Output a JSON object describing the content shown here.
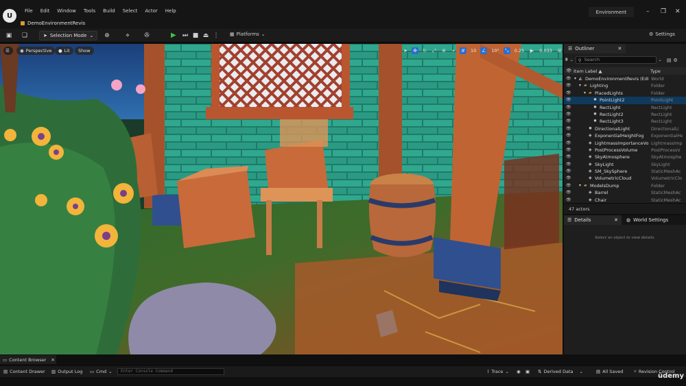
{
  "app": {
    "logo": "unreal-engine-logo",
    "menu": [
      "File",
      "Edit",
      "Window",
      "Tools",
      "Build",
      "Select",
      "Actor",
      "Help"
    ],
    "project_tab": "DemoEnvironmentRevis",
    "environment_label": "Environment"
  },
  "toolbar": {
    "selection_mode": "Selection Mode",
    "platforms": "Platforms",
    "settings": "Settings"
  },
  "viewport": {
    "perspective": "Perspective",
    "lit": "Lit",
    "show": "Show",
    "grid_snap": "10",
    "rotation_snap": "10°",
    "scale_snap": "0.25",
    "camera_speed": "0.033"
  },
  "outliner": {
    "tab_label": "Outliner",
    "search_placeholder": "Search",
    "col_label": "Item Label ▲",
    "col_type": "Type",
    "rows": [
      {
        "name": "DemoEnvironmentRevis (Edit",
        "type": "World",
        "indent": 0,
        "icon": "world",
        "selected": false
      },
      {
        "name": "Lighting",
        "type": "Folder",
        "indent": 1,
        "icon": "folder",
        "selected": false
      },
      {
        "name": "PlacedLights",
        "type": "Folder",
        "indent": 2,
        "icon": "folder",
        "selected": false
      },
      {
        "name": "PointLight2",
        "type": "PointLight",
        "indent": 3,
        "icon": "light",
        "selected": true
      },
      {
        "name": "RectLight",
        "type": "RectLight",
        "indent": 3,
        "icon": "light",
        "selected": false
      },
      {
        "name": "RectLight2",
        "type": "RectLight",
        "indent": 3,
        "icon": "light",
        "selected": false
      },
      {
        "name": "RectLight3",
        "type": "RectLight",
        "indent": 3,
        "icon": "light",
        "selected": false
      },
      {
        "name": "DirectionalLight",
        "type": "DirectionalLi",
        "indent": 2,
        "icon": "light",
        "selected": false
      },
      {
        "name": "ExponentialHeightFog",
        "type": "ExponentialHe",
        "indent": 2,
        "icon": "actor",
        "selected": false
      },
      {
        "name": "LightmassImportanceVol",
        "type": "LightmassImp",
        "indent": 2,
        "icon": "actor",
        "selected": false
      },
      {
        "name": "PostProcessVolume",
        "type": "PostProcessV",
        "indent": 2,
        "icon": "actor",
        "selected": false
      },
      {
        "name": "SkyAtmosphere",
        "type": "SkyAtmosphe",
        "indent": 2,
        "icon": "actor",
        "selected": false
      },
      {
        "name": "SkyLight",
        "type": "SkyLight",
        "indent": 2,
        "icon": "actor",
        "selected": false
      },
      {
        "name": "SM_SkySphere",
        "type": "StaticMeshAc",
        "indent": 2,
        "icon": "actor",
        "selected": false
      },
      {
        "name": "VolumetricCloud",
        "type": "VolumetricClo",
        "indent": 2,
        "icon": "actor",
        "selected": false
      },
      {
        "name": "ModelsDump",
        "type": "Folder",
        "indent": 1,
        "icon": "folder",
        "selected": false
      },
      {
        "name": "Barrel",
        "type": "StaticMeshAc",
        "indent": 2,
        "icon": "actor",
        "selected": false
      },
      {
        "name": "Chair",
        "type": "StaticMeshAc",
        "indent": 2,
        "icon": "actor",
        "selected": false
      }
    ],
    "actor_count": "47 actors"
  },
  "details": {
    "tab_label": "Details",
    "world_settings_label": "World Settings",
    "empty_message": "Select an object to view details."
  },
  "bottom": {
    "content_browser_tab": "Content Browser",
    "content_drawer": "Content Drawer",
    "output_log": "Output Log",
    "cmd": "Cmd",
    "console_placeholder": "Enter Console Command",
    "trace": "Trace",
    "derived_data": "Derived Data",
    "all_saved": "All Saved",
    "revision_control": "Revision Control",
    "watermark": "ūdemy"
  },
  "colors": {
    "accent_blue": "#2a6fd0",
    "selection_row": "#103a5c",
    "play_green": "#43c043",
    "folder_yellow": "#c89a45"
  }
}
